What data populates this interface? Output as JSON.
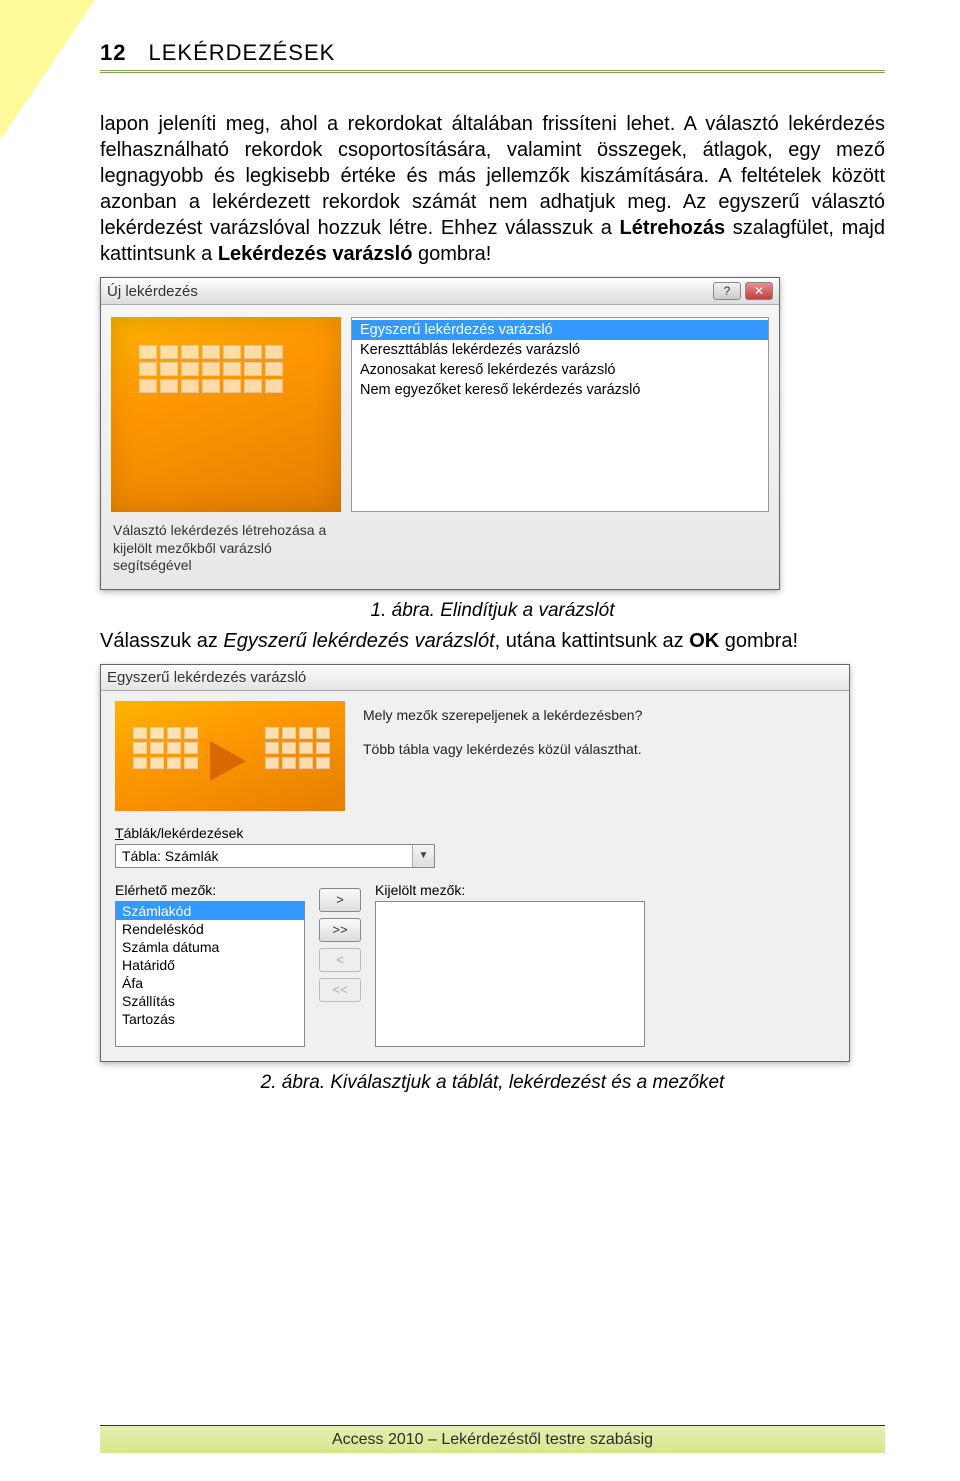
{
  "header": {
    "page_number": "12",
    "title": "LEKÉRDEZÉSEK"
  },
  "body": {
    "p1": "lapon jeleníti meg, ahol a rekordokat általában frissíteni lehet. A választó lekérdezés felhasználható rekordok csoportosítására, valamint összegek, átlagok, egy mező legnagyobb és legkisebb értéke és más jellemzők kiszámítására. A feltételek között azonban a lekérdezett rekordok számát nem adhatjuk meg. Az egyszerű választó lekérdezést varázslóval hozzuk létre. Ehhez válasszuk a ",
    "p1_bold1": "Létrehozás",
    "p1_mid": " szalagfület, majd kattintsunk a ",
    "p1_bold2": "Lekérdezés varázsló",
    "p1_end": " gombra!"
  },
  "dialog1": {
    "title": "Új lekérdezés",
    "help_btn": "?",
    "close_btn": "✕",
    "options": [
      "Egyszerű lekérdezés varázsló",
      "Kereszttáblás lekérdezés varázsló",
      "Azonosakat kereső lekérdezés varázsló",
      "Nem egyezőket kereső lekérdezés varázsló"
    ],
    "description": "Választó lekérdezés létrehozása a kijelölt mezőkből varázsló segítségével"
  },
  "caption1": "1. ábra. Elindítjuk a varázslót",
  "p2_a": "Válasszuk az ",
  "p2_em": "Egyszerű lekérdezés varázslót",
  "p2_b": ", utána kattintsunk az ",
  "p2_bold": "OK",
  "p2_c": " gombra!",
  "dialog2": {
    "title": "Egyszerű lekérdezés varázsló",
    "q1": "Mely mezők szerepeljenek a lekérdezésben?",
    "q2": "Több tábla vagy lekérdezés közül választhat.",
    "tables_label": "Táblák/lekérdezések",
    "combo_value": "Tábla: Számlák",
    "available_label": "Elérhető mezők:",
    "selected_label": "Kijelölt mezők:",
    "available_fields": [
      "Számlakód",
      "Rendeléskód",
      "Számla dátuma",
      "Határidő",
      "Áfa",
      "Szállítás",
      "Tartozás"
    ],
    "btn_add": ">",
    "btn_add_all": ">>",
    "btn_remove": "<",
    "btn_remove_all": "<<"
  },
  "caption2": "2. ábra. Kiválasztjuk a táblát, lekérdezést és a mezőket",
  "footer": "Access 2010 – Lekérdezéstől testre szabásig"
}
